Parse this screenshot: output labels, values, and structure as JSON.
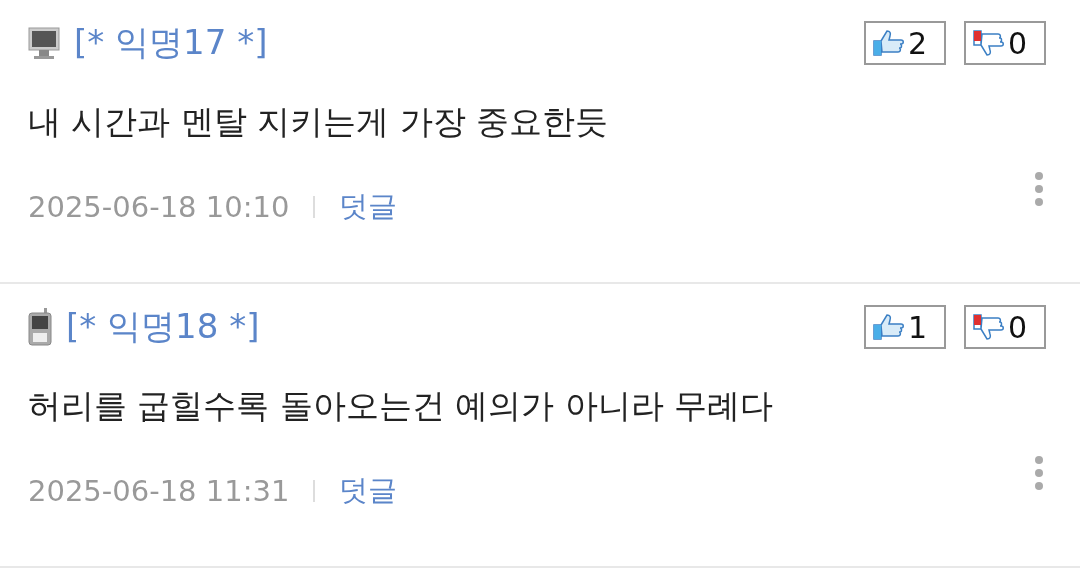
{
  "comments": [
    {
      "kind": "pc",
      "author": "[* 익명17 *]",
      "likes": "2",
      "dislikes": "0",
      "body": "내 시간과 멘탈 지키는게 가장 중요한듯",
      "date": "2025-06-18 10:10",
      "reply": "덧글"
    },
    {
      "kind": "mobile",
      "author": "[* 익명18 *]",
      "likes": "1",
      "dislikes": "0",
      "body": "허리를 굽힐수록 돌아오는건 예의가 아니라 무례다",
      "date": "2025-06-18 11:31",
      "reply": "덧글"
    }
  ]
}
